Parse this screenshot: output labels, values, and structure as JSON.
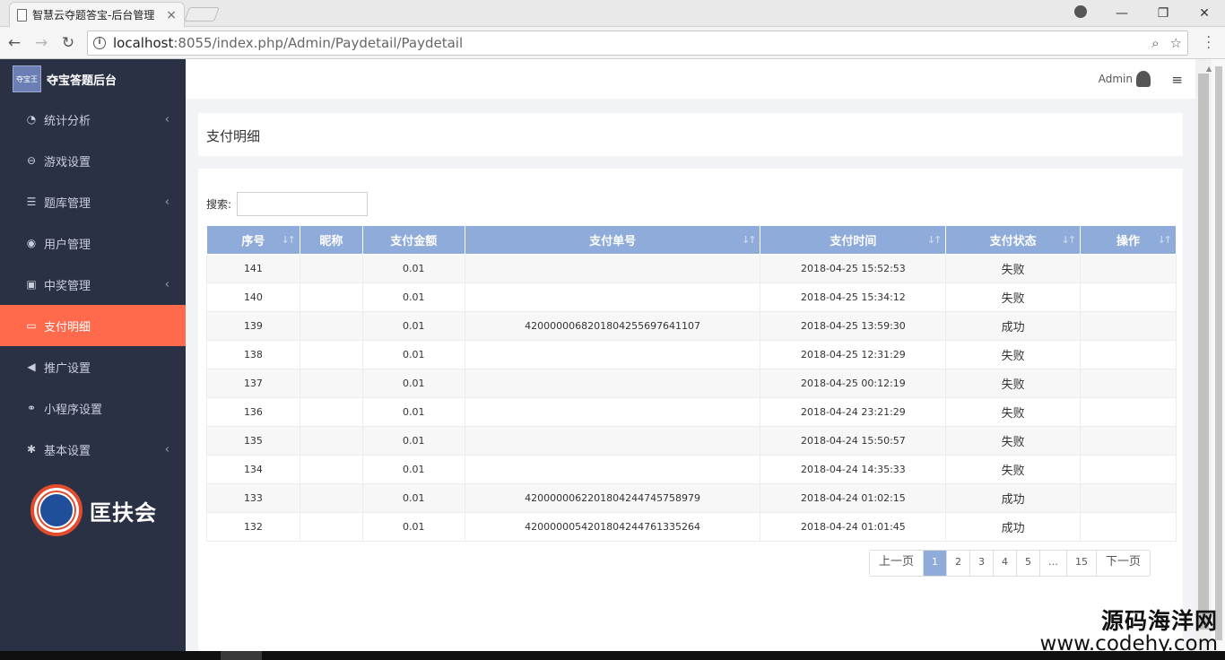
{
  "browser": {
    "tab_title": "智慧云夺题答宝-后台管理",
    "tab_close": "×",
    "url_host": "localhost",
    "url_rest": ":8055/index.php/Admin/Paydetail/Paydetail",
    "nav": {
      "back": "←",
      "forward": "→",
      "reload": "↻"
    },
    "window": {
      "minimize": "—",
      "maximize": "❐",
      "close": "✕"
    },
    "omni_icons": {
      "zoom": "⌕",
      "star": "☆"
    }
  },
  "sidebar": {
    "brand_title": "夺宝答题后台",
    "brand_logo_text": "夺宝王",
    "items": [
      {
        "label": "统计分析",
        "icon": "pie-chart-icon",
        "glyph": "◔",
        "chevron": "‹"
      },
      {
        "label": "游戏设置",
        "icon": "gamepad-icon",
        "glyph": "⊖",
        "chevron": ""
      },
      {
        "label": "题库管理",
        "icon": "list-icon",
        "glyph": "☰",
        "chevron": "‹"
      },
      {
        "label": "用户管理",
        "icon": "user-icon",
        "glyph": "◉",
        "chevron": ""
      },
      {
        "label": "中奖管理",
        "icon": "award-icon",
        "glyph": "▣",
        "chevron": "‹"
      },
      {
        "label": "支付明细",
        "icon": "credit-card-icon",
        "glyph": "▭",
        "chevron": ""
      },
      {
        "label": "推广设置",
        "icon": "bullhorn-icon",
        "glyph": "◀",
        "chevron": ""
      },
      {
        "label": "小程序设置",
        "icon": "link-icon",
        "glyph": "⚭",
        "chevron": ""
      },
      {
        "label": "基本设置",
        "icon": "gear-icon",
        "glyph": "✱",
        "chevron": "‹"
      }
    ],
    "active_index": 5,
    "seal_text": "匡扶会"
  },
  "header": {
    "admin_name": "Admin",
    "menu_glyph": "≡"
  },
  "page": {
    "title": "支付明细",
    "search_label": "搜索:",
    "search_value": ""
  },
  "table": {
    "columns": [
      {
        "label": "序号",
        "sort": "↓↑"
      },
      {
        "label": "昵称",
        "sort": ""
      },
      {
        "label": "支付金额",
        "sort": ""
      },
      {
        "label": "支付单号",
        "sort": "↓↑"
      },
      {
        "label": "支付时间",
        "sort": "↓↑"
      },
      {
        "label": "支付状态",
        "sort": "↓↑"
      },
      {
        "label": "操作",
        "sort": "↓↑"
      }
    ],
    "rows": [
      [
        "141",
        "",
        "0.01",
        "",
        "2018-04-25 15:52:53",
        "失败",
        ""
      ],
      [
        "140",
        "",
        "0.01",
        "",
        "2018-04-25 15:34:12",
        "失败",
        ""
      ],
      [
        "139",
        "",
        "0.01",
        "4200000068201804255697641107",
        "2018-04-25 13:59:30",
        "成功",
        ""
      ],
      [
        "138",
        "",
        "0.01",
        "",
        "2018-04-25 12:31:29",
        "失败",
        ""
      ],
      [
        "137",
        "",
        "0.01",
        "",
        "2018-04-25 00:12:19",
        "失败",
        ""
      ],
      [
        "136",
        "",
        "0.01",
        "",
        "2018-04-24 23:21:29",
        "失败",
        ""
      ],
      [
        "135",
        "",
        "0.01",
        "",
        "2018-04-24 15:50:57",
        "失败",
        ""
      ],
      [
        "134",
        "",
        "0.01",
        "",
        "2018-04-24 14:35:33",
        "失败",
        ""
      ],
      [
        "133",
        "",
        "0.01",
        "4200000062201804244745758979",
        "2018-04-24 01:02:15",
        "成功",
        ""
      ],
      [
        "132",
        "",
        "0.01",
        "4200000054201804244761335264",
        "2018-04-24 01:01:45",
        "成功",
        ""
      ]
    ]
  },
  "pagination": {
    "prev": "上一页",
    "pages": [
      "1",
      "2",
      "3",
      "4",
      "5",
      "…",
      "15"
    ],
    "active": "1",
    "next": "下一页"
  },
  "watermark": {
    "cn": "源码海洋网",
    "en": "www.codehy.com"
  }
}
